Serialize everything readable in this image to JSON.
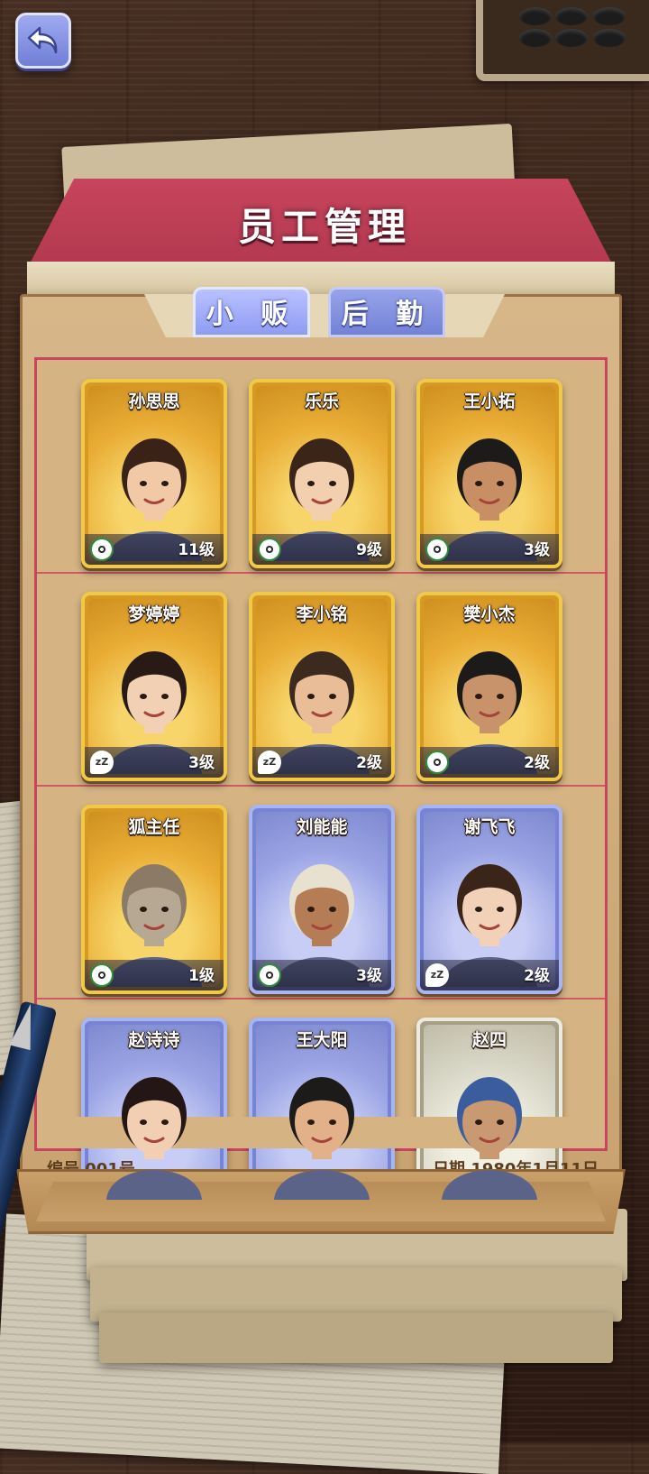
{
  "header": {
    "title": "员工管理"
  },
  "tabs": [
    {
      "label": "小 贩",
      "active": true
    },
    {
      "label": "后 勤",
      "active": false
    }
  ],
  "employees": [
    {
      "name": "孙思思",
      "level": "11级",
      "frame": "gold",
      "status": "working",
      "skin": "#f1c9a6",
      "hair": "#3a2218"
    },
    {
      "name": "乐乐",
      "level": "9级",
      "frame": "gold",
      "status": "working",
      "skin": "#f2cfae",
      "hair": "#3b2418"
    },
    {
      "name": "王小拓",
      "level": "3级",
      "frame": "gold",
      "status": "working",
      "skin": "#c98f64",
      "hair": "#1d1a1a"
    },
    {
      "name": "梦婷婷",
      "level": "3级",
      "frame": "gold",
      "status": "sleeping",
      "skin": "#f1d0b3",
      "hair": "#2a1a16"
    },
    {
      "name": "李小铭",
      "level": "2级",
      "frame": "gold",
      "status": "sleeping",
      "skin": "#e8bd98",
      "hair": "#3c2a1e"
    },
    {
      "name": "樊小杰",
      "level": "2级",
      "frame": "gold",
      "status": "working",
      "skin": "#c8926a",
      "hair": "#1d1a1a"
    },
    {
      "name": "狐主任",
      "level": "1级",
      "frame": "gold",
      "status": "working",
      "skin": "#b7a894",
      "hair": "#8a7a66"
    },
    {
      "name": "刘能能",
      "level": "3级",
      "frame": "blue",
      "status": "working",
      "skin": "#b57d55",
      "hair": "#e9e1cf"
    },
    {
      "name": "谢飞飞",
      "level": "2级",
      "frame": "blue",
      "status": "sleeping",
      "skin": "#f1d2b8",
      "hair": "#3b2418"
    },
    {
      "name": "赵诗诗",
      "level": "",
      "frame": "blue",
      "status": "",
      "skin": "#f2cfb2",
      "hair": "#241614"
    },
    {
      "name": "王大阳",
      "level": "",
      "frame": "blue",
      "status": "",
      "skin": "#e2b18a",
      "hair": "#1d1a1a"
    },
    {
      "name": "赵四",
      "level": "",
      "frame": "white",
      "status": "",
      "skin": "#c99a72",
      "hair": "#3b5d9e"
    }
  ],
  "footer": {
    "number_label": "编号 001号",
    "date_label": "日期 1980年1月11日"
  },
  "colors": {
    "gold_frame": "#f0c84a",
    "blue_frame": "#a9b4f3",
    "folder_red": "#c7455c",
    "tab_blue": "#8e9cf2"
  },
  "icons": {
    "back": "back-arrow-icon",
    "working": "gear-icon",
    "sleeping": "sleep-zzz-icon"
  }
}
